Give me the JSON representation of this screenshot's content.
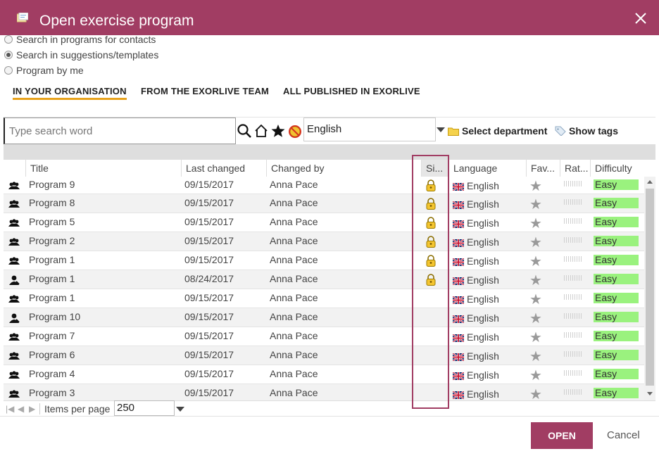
{
  "dialog": {
    "title": "Open exercise program"
  },
  "search_options": [
    {
      "label": "Search in programs for contacts",
      "checked": false
    },
    {
      "label": "Search in suggestions/templates",
      "checked": true
    },
    {
      "label": "Program by me",
      "checked": false
    }
  ],
  "tabs": [
    {
      "label": "IN YOUR ORGANISATION",
      "active": true
    },
    {
      "label": "FROM THE EXORLIVE TEAM",
      "active": false
    },
    {
      "label": "ALL PUBLISHED IN EXORLIVE",
      "active": false
    }
  ],
  "toolbar": {
    "search_placeholder": "Type search word",
    "language": "English",
    "select_department": "Select department",
    "show_tags": "Show tags"
  },
  "table": {
    "columns": [
      "Title",
      "Last changed",
      "Changed by",
      "Si...",
      "Language",
      "Fav...",
      "Rat...",
      "Difficulty"
    ],
    "rows": [
      {
        "type": "group",
        "title": "Program 9",
        "changed": "09/15/2017",
        "by": "Anna Pace",
        "locked": true,
        "language": "English",
        "difficulty": "Easy"
      },
      {
        "type": "group",
        "title": "Program 8",
        "changed": "09/15/2017",
        "by": "Anna Pace",
        "locked": true,
        "language": "English",
        "difficulty": "Easy"
      },
      {
        "type": "group",
        "title": "Program 5",
        "changed": "09/15/2017",
        "by": "Anna Pace",
        "locked": true,
        "language": "English",
        "difficulty": "Easy"
      },
      {
        "type": "group",
        "title": "Program 2",
        "changed": "09/15/2017",
        "by": "Anna Pace",
        "locked": true,
        "language": "English",
        "difficulty": "Easy"
      },
      {
        "type": "group",
        "title": "Program 1",
        "changed": "09/15/2017",
        "by": "Anna Pace",
        "locked": true,
        "language": "English",
        "difficulty": "Easy"
      },
      {
        "type": "single",
        "title": "Program 1",
        "changed": "08/24/2017",
        "by": "Anna Pace",
        "locked": true,
        "language": "English",
        "difficulty": "Easy"
      },
      {
        "type": "group",
        "title": "Program 1",
        "changed": "09/15/2017",
        "by": "Anna Pace",
        "locked": false,
        "language": "English",
        "difficulty": "Easy"
      },
      {
        "type": "single",
        "title": "Program 10",
        "changed": "09/15/2017",
        "by": "Anna Pace",
        "locked": false,
        "language": "English",
        "difficulty": "Easy"
      },
      {
        "type": "group",
        "title": "Program 7",
        "changed": "09/15/2017",
        "by": "Anna Pace",
        "locked": false,
        "language": "English",
        "difficulty": "Easy"
      },
      {
        "type": "group",
        "title": "Program 6",
        "changed": "09/15/2017",
        "by": "Anna Pace",
        "locked": false,
        "language": "English",
        "difficulty": "Easy"
      },
      {
        "type": "group",
        "title": "Program 4",
        "changed": "09/15/2017",
        "by": "Anna Pace",
        "locked": false,
        "language": "English",
        "difficulty": "Easy"
      },
      {
        "type": "group",
        "title": "Program 3",
        "changed": "09/15/2017",
        "by": "Anna Pace",
        "locked": false,
        "language": "English",
        "difficulty": "Easy"
      }
    ]
  },
  "pager": {
    "label": "Items per page",
    "value": "250"
  },
  "footer": {
    "open": "OPEN",
    "cancel": "Cancel"
  },
  "colors": {
    "brand": "#a13d63",
    "tab_underline": "#e8a21c",
    "difficulty_easy": "#9af27e"
  }
}
